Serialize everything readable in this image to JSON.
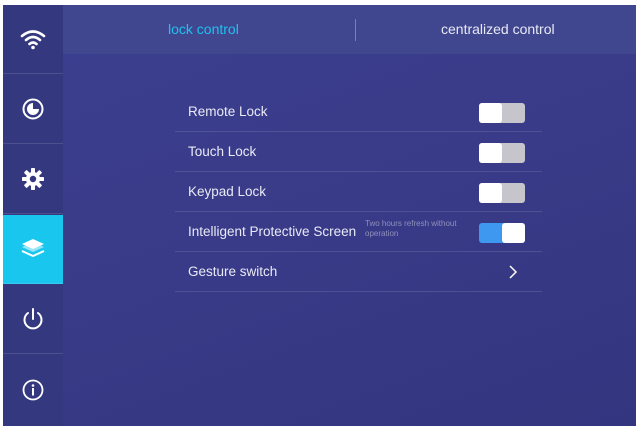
{
  "sidebar": {
    "items": [
      {
        "icon": "wifi-icon",
        "active": false
      },
      {
        "icon": "clock-icon",
        "active": false
      },
      {
        "icon": "gear-icon",
        "active": false
      },
      {
        "icon": "layers-icon",
        "active": true
      },
      {
        "icon": "power-icon",
        "active": false
      },
      {
        "icon": "info-icon",
        "active": false
      }
    ]
  },
  "header": {
    "tabs": [
      {
        "label": "lock control",
        "active": true
      },
      {
        "label": "centralized control",
        "active": false
      }
    ]
  },
  "settings": [
    {
      "label": "Remote Lock",
      "control": "toggle",
      "on": false
    },
    {
      "label": "Touch Lock",
      "control": "toggle",
      "on": false
    },
    {
      "label": "Keypad Lock",
      "control": "toggle",
      "on": false
    },
    {
      "label": "Intelligent Protective Screen",
      "hint": "Two hours refresh without operation",
      "control": "toggle",
      "on": true
    },
    {
      "label": "Gesture switch",
      "control": "chevron"
    }
  ],
  "colors": {
    "accent": "#19c7ee",
    "toggle_on": "#3e98ef",
    "toggle_off": "#c5c5cb",
    "background": "#3a3c8a"
  }
}
